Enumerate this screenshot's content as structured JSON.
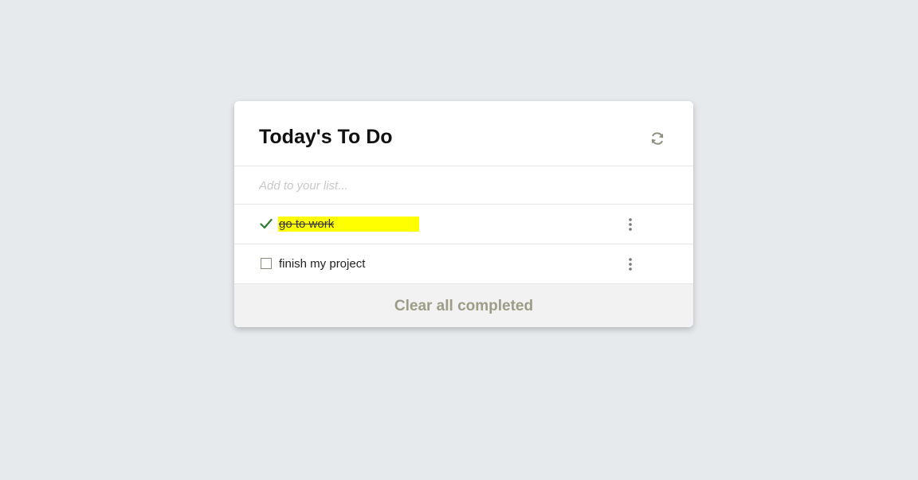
{
  "app": {
    "title": "Today's To Do"
  },
  "input": {
    "placeholder": "Add to your list...",
    "value": ""
  },
  "todos": [
    {
      "text": "go to work",
      "completed": true,
      "highlight_color": "#ffff00"
    },
    {
      "text": "finish my project",
      "completed": false
    }
  ],
  "footer": {
    "clear_label": "Clear all completed"
  },
  "icons": {
    "refresh": "refresh-icon",
    "check": "check-icon",
    "checkbox": "checkbox-empty",
    "menu": "more-vertical-icon"
  },
  "colors": {
    "background": "#e6eaed",
    "check_green": "#2e7d32",
    "muted_olive": "#9c9c87",
    "highlight": "#ffff00"
  }
}
